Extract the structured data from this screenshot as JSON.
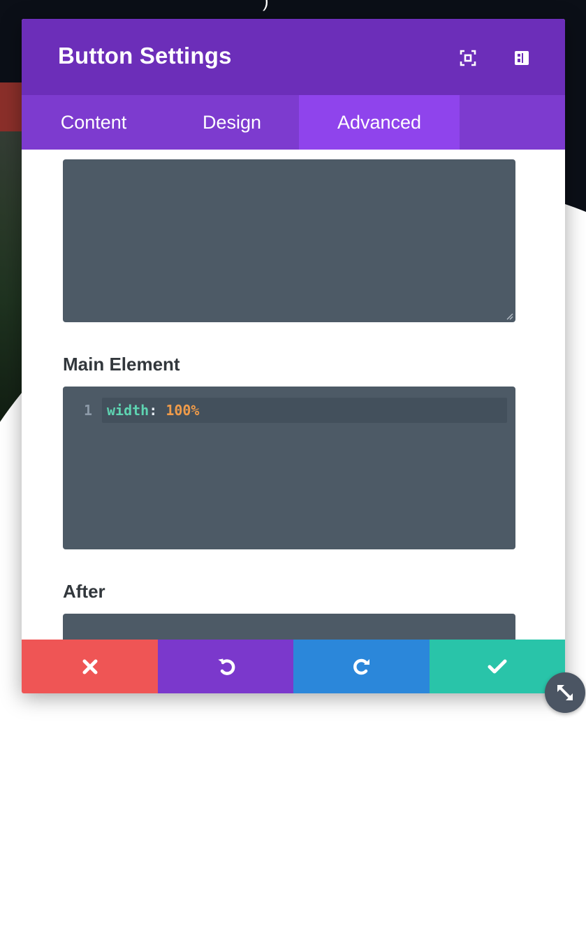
{
  "modal": {
    "title": "Button Settings",
    "header_icons": [
      "fullscreen-icon",
      "sidebar-layout-icon"
    ],
    "tabs": [
      {
        "label": "Content",
        "active": false
      },
      {
        "label": "Design",
        "active": false
      },
      {
        "label": "Advanced",
        "active": true
      }
    ]
  },
  "fields": {
    "before": {
      "label": "",
      "content": ""
    },
    "main_element": {
      "label": "Main Element",
      "line_number": "1",
      "code_property": "width",
      "code_colon": ":",
      "code_value": "100%"
    },
    "after": {
      "label": "After",
      "content": ""
    }
  },
  "footer": {
    "buttons": [
      {
        "name": "discard",
        "icon": "close-icon",
        "color": "#ef5555"
      },
      {
        "name": "undo",
        "icon": "undo-icon",
        "color": "#7b38cc"
      },
      {
        "name": "redo",
        "icon": "redo-icon",
        "color": "#2b87da"
      },
      {
        "name": "save",
        "icon": "check-icon",
        "color": "#29c4a9"
      }
    ]
  },
  "colors": {
    "header": "#6c2eb9",
    "tabs": "#7d3bcf",
    "active_tab": "#8f44ec",
    "code_bg": "#4d5a66",
    "expand_button": "#4b5563"
  },
  "expand_icon": "resize-diagonal-icon"
}
